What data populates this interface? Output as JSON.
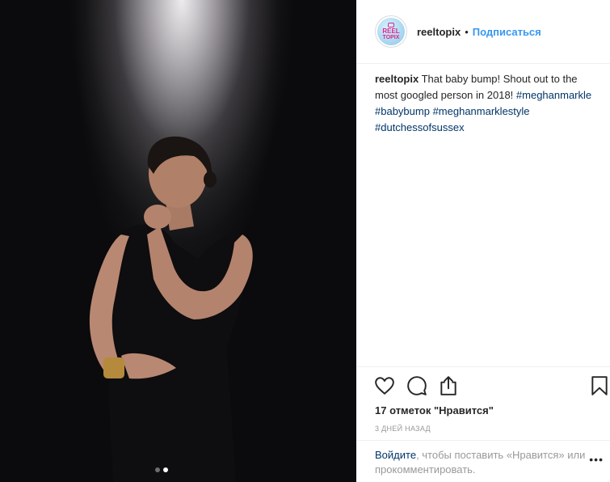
{
  "post": {
    "username": "reeltopix",
    "separator": "•",
    "follow_label": "Подписаться",
    "avatar": {
      "line1": "REEL",
      "line2": "TOPIX"
    },
    "caption": {
      "username": "reeltopix",
      "text": " That baby bump! Shout out to the most googled person in 2018! ",
      "hashtags": [
        "#meghanmarkle",
        "#babybump",
        "#meghanmarklestyle",
        "#dutchessofsussex"
      ]
    },
    "likes_text": "17 отметок \"Нравится\"",
    "time_text": "3 дней назад",
    "login_prompt": {
      "link": "Войдите",
      "rest": ", чтобы поставить «Нравится» или прокомментировать."
    },
    "more_label": "•••",
    "carousel": {
      "count": 2,
      "active_index": 1
    }
  },
  "icons": [
    "heart-icon",
    "comment-icon",
    "share-icon",
    "bookmark-icon"
  ],
  "colors": {
    "link": "#3897f0",
    "hashtag": "#003569",
    "muted": "#999999",
    "text": "#262626"
  }
}
